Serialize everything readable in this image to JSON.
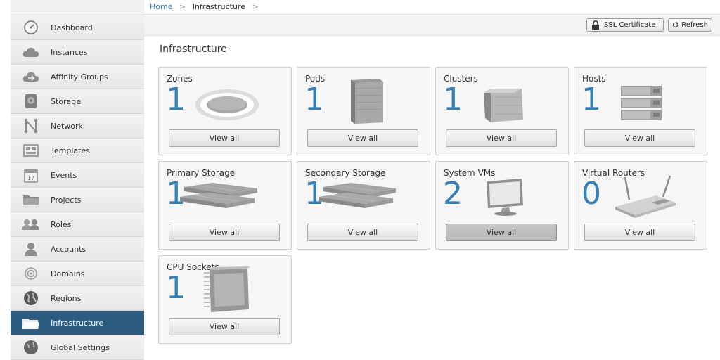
{
  "breadcrumb": {
    "home": "Home",
    "sep1": ">",
    "current": "Infrastructure",
    "sep2": ">"
  },
  "toolbar": {
    "ssl_label": "SSL Certificate",
    "refresh_label": "Refresh"
  },
  "page_title": "Infrastructure",
  "sidebar": {
    "items": [
      {
        "label": "Dashboard",
        "icon": "dashboard-icon"
      },
      {
        "label": "Instances",
        "icon": "cloud-icon"
      },
      {
        "label": "Affinity Groups",
        "icon": "affinity-cloud-icon"
      },
      {
        "label": "Storage",
        "icon": "storage-disk-icon"
      },
      {
        "label": "Network",
        "icon": "network-icon"
      },
      {
        "label": "Templates",
        "icon": "templates-icon"
      },
      {
        "label": "Events",
        "icon": "calendar-icon"
      },
      {
        "label": "Projects",
        "icon": "folder-icon"
      },
      {
        "label": "Roles",
        "icon": "roles-icon"
      },
      {
        "label": "Accounts",
        "icon": "user-icon"
      },
      {
        "label": "Domains",
        "icon": "domains-icon"
      },
      {
        "label": "Regions",
        "icon": "globe-icon"
      },
      {
        "label": "Infrastructure",
        "icon": "infrastructure-folder-icon",
        "active": true
      },
      {
        "label": "Global Settings",
        "icon": "globe-settings-icon"
      }
    ]
  },
  "cards": [
    {
      "title": "Zones",
      "count": "1",
      "view": "View all",
      "icon": "zone-icon"
    },
    {
      "title": "Pods",
      "count": "1",
      "view": "View all",
      "icon": "pod-icon"
    },
    {
      "title": "Clusters",
      "count": "1",
      "view": "View all",
      "icon": "cluster-icon"
    },
    {
      "title": "Hosts",
      "count": "1",
      "view": "View all",
      "icon": "host-icon"
    },
    {
      "title": "Primary Storage",
      "count": "1",
      "view": "View all",
      "icon": "primary-storage-icon"
    },
    {
      "title": "Secondary Storage",
      "count": "1",
      "view": "View all",
      "icon": "secondary-storage-icon"
    },
    {
      "title": "System VMs",
      "count": "2",
      "view": "View all",
      "icon": "monitor-icon",
      "pressed": true
    },
    {
      "title": "Virtual Routers",
      "count": "0",
      "view": "View all",
      "icon": "router-icon"
    },
    {
      "title": "CPU Sockets",
      "count": "1",
      "view": "View all",
      "icon": "cpu-icon"
    }
  ]
}
